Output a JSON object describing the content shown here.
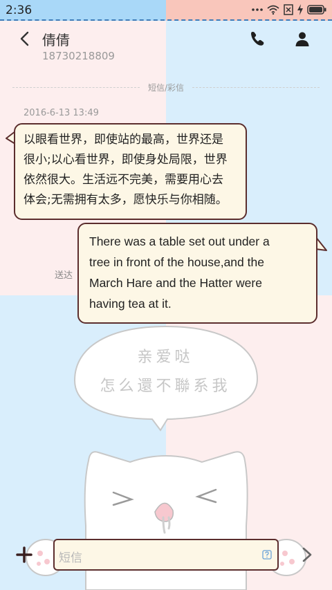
{
  "status_bar": {
    "time": "2:36"
  },
  "header": {
    "contact_name": "倩倩",
    "contact_number": "18730218809"
  },
  "thread": {
    "divider_label": "短信/彩信",
    "timestamp": "2016-6-13 13:49",
    "messages": [
      {
        "direction": "incoming",
        "lines": [
          "以眼看世界，即使站的最高，世界还是",
          "很小;以心看世界，即使身处局限，世界",
          "依然很大。生活远不完美，需要用心去",
          "体会;无需拥有太多，愿快乐与你相随。"
        ]
      },
      {
        "direction": "outgoing",
        "lines": [
          "There was a table set out under a",
          "tree in front of the house,and the",
          "March Hare and the Hatter were",
          "having tea at it."
        ],
        "status": "送达"
      }
    ]
  },
  "wallpaper": {
    "cloud_line1": "亲爱哒",
    "cloud_line2": "怎么還不聯系我"
  },
  "composer": {
    "placeholder": "短信"
  },
  "colors": {
    "bubble_border": "#5b2d2d",
    "bubble_fill": "#fdf7e6",
    "pink": "#fdeeee",
    "blue": "#d9eefc",
    "status_blue": "#a9d8f8",
    "status_pink": "#f9c6bb"
  },
  "icons": [
    "wifi-icon",
    "sim-icon",
    "charging-icon",
    "battery-icon",
    "back-icon",
    "phone-icon",
    "person-icon",
    "add-icon",
    "info-icon",
    "send-icon"
  ]
}
